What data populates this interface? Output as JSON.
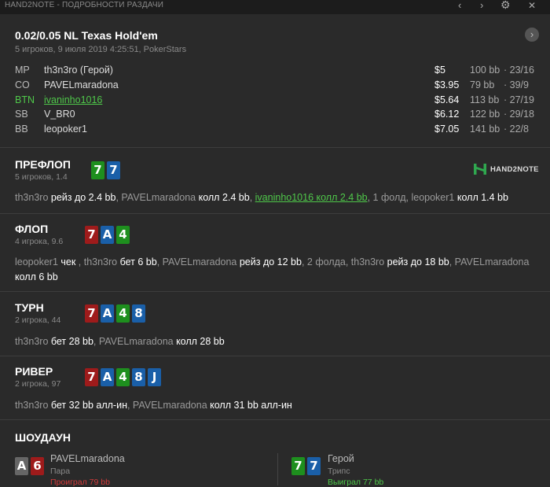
{
  "window": {
    "title": "HAND2NOTE - ПОДРОБНОСТИ РАЗДАЧИ",
    "prev_icon": "chevron-left",
    "next_icon": "chevron-right",
    "settings_icon": "gear",
    "close_icon": "close"
  },
  "header": {
    "title": "0.02/0.05 NL Texas Hold'em",
    "subtitle": "5 игроков, 9 июля 2019 4:25:51, PokerStars"
  },
  "players": [
    {
      "pos": "MP",
      "name": "th3n3ro (Герой)",
      "stack": "$5",
      "bb": "100 bb",
      "stats": "·  23/16",
      "highlight": false
    },
    {
      "pos": "CO",
      "name": "PAVELmaradona",
      "stack": "$3.95",
      "bb": "79 bb",
      "stats": "·  39/9",
      "highlight": false
    },
    {
      "pos": "BTN",
      "name": "ivaninho1016",
      "stack": "$5.64",
      "bb": "113 bb",
      "stats": "·  27/19",
      "highlight": true
    },
    {
      "pos": "SB",
      "name": "V_BR0",
      "stack": "$6.12",
      "bb": "122 bb",
      "stats": "·  29/18",
      "highlight": false
    },
    {
      "pos": "BB",
      "name": "leopoker1",
      "stack": "$7.05",
      "bb": "141 bb",
      "stats": "·  22/8",
      "highlight": false
    }
  ],
  "logo": {
    "text": "HAND2NOTE"
  },
  "streets": {
    "preflop": {
      "title": "ПРЕФЛОП",
      "sub": "5 игроков, 1.4",
      "cards": [
        {
          "rank": "7",
          "color": "#1e8f1e"
        },
        {
          "rank": "7",
          "color": "#1a5fa8"
        }
      ],
      "actions": [
        {
          "t": "th3n3ro ",
          "c": "n"
        },
        {
          "t": "рейз до 2.4 bb",
          "c": "a"
        },
        {
          "t": ", PAVELmaradona ",
          "c": "n"
        },
        {
          "t": "колл 2.4 bb",
          "c": "a"
        },
        {
          "t": ", ",
          "c": "n"
        },
        {
          "t": "ivaninho1016 колл 2.4 bb",
          "c": "g"
        },
        {
          "t": ", 1 фолд, leopoker1 ",
          "c": "n"
        },
        {
          "t": "колл 1.4 bb",
          "c": "a"
        }
      ]
    },
    "flop": {
      "title": "ФЛОП",
      "sub": "4 игрока, 9.6",
      "cards": [
        {
          "rank": "7",
          "color": "#9e1b1b"
        },
        {
          "rank": "A",
          "color": "#1a5fa8"
        },
        {
          "rank": "4",
          "color": "#1e8f1e"
        }
      ],
      "actions": [
        {
          "t": "leopoker1 ",
          "c": "n"
        },
        {
          "t": "чек",
          "c": "a"
        },
        {
          "t": " , th3n3ro ",
          "c": "n"
        },
        {
          "t": "бет 6 bb",
          "c": "a"
        },
        {
          "t": ", PAVELmaradona ",
          "c": "n"
        },
        {
          "t": "рейз до 12 bb",
          "c": "a"
        },
        {
          "t": ", 2 фолда, th3n3ro ",
          "c": "n"
        },
        {
          "t": "рейз до 18 bb",
          "c": "a"
        },
        {
          "t": ", PAVELmaradona ",
          "c": "n"
        },
        {
          "t": "колл 6 bb",
          "c": "a"
        }
      ]
    },
    "turn": {
      "title": "ТУРН",
      "sub": "2 игрока, 44",
      "cards": [
        {
          "rank": "7",
          "color": "#9e1b1b"
        },
        {
          "rank": "A",
          "color": "#1a5fa8"
        },
        {
          "rank": "4",
          "color": "#1e8f1e"
        },
        {
          "rank": "8",
          "color": "#1a5fa8"
        }
      ],
      "actions": [
        {
          "t": "th3n3ro ",
          "c": "n"
        },
        {
          "t": "бет 28 bb",
          "c": "a"
        },
        {
          "t": ", PAVELmaradona ",
          "c": "n"
        },
        {
          "t": "колл 28 bb",
          "c": "a"
        }
      ]
    },
    "river": {
      "title": "РИВЕР",
      "sub": "2 игрока, 97",
      "cards": [
        {
          "rank": "7",
          "color": "#9e1b1b"
        },
        {
          "rank": "A",
          "color": "#1a5fa8"
        },
        {
          "rank": "4",
          "color": "#1e8f1e"
        },
        {
          "rank": "8",
          "color": "#1a5fa8"
        },
        {
          "rank": "J",
          "color": "#1a5fa8"
        }
      ],
      "actions": [
        {
          "t": "th3n3ro ",
          "c": "n"
        },
        {
          "t": "бет 32 bb алл-ин",
          "c": "a"
        },
        {
          "t": ", PAVELmaradona ",
          "c": "n"
        },
        {
          "t": "колл 31 bb алл-ин",
          "c": "a"
        }
      ]
    }
  },
  "showdown": {
    "title": "ШОУДАУН",
    "left": {
      "name": "PAVELmaradona",
      "hand": "Пара",
      "result": "Проиграл 79 bb",
      "result_color": "#d23a3a",
      "cards": [
        {
          "rank": "A",
          "color": "#666666"
        },
        {
          "rank": "6",
          "color": "#9e1b1b"
        }
      ]
    },
    "right": {
      "name": "Герой",
      "hand": "Трипс",
      "result": "Выиграл 77 bb",
      "result_color": "#4fc84a",
      "cards": [
        {
          "rank": "7",
          "color": "#1e8f1e"
        },
        {
          "rank": "7",
          "color": "#1a5fa8"
        }
      ]
    }
  }
}
